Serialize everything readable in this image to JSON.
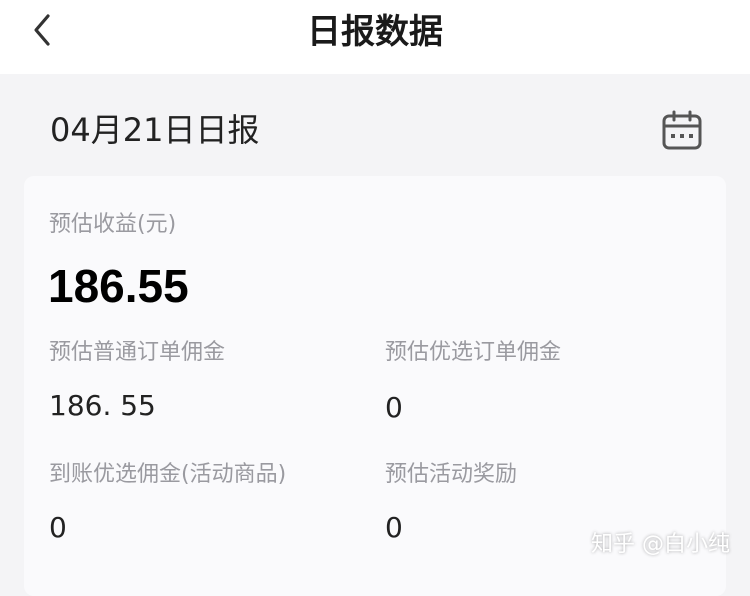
{
  "header": {
    "title": "日报数据",
    "back_icon": "chevron-left-icon"
  },
  "report": {
    "date_title": "04月21日日报",
    "calendar_icon": "calendar-icon"
  },
  "summary": {
    "estimated_income_label": "预估收益(元)",
    "estimated_income_value": "186.55"
  },
  "metrics": [
    {
      "label": "预估普通订单佣金",
      "value": "186. 55"
    },
    {
      "label": "预估优选订单佣金",
      "value": "0"
    },
    {
      "label": "到账优选佣金(活动商品)",
      "value": "0"
    },
    {
      "label": "预估活动奖励",
      "value": "0"
    }
  ],
  "watermark": "知乎 @白小纯"
}
